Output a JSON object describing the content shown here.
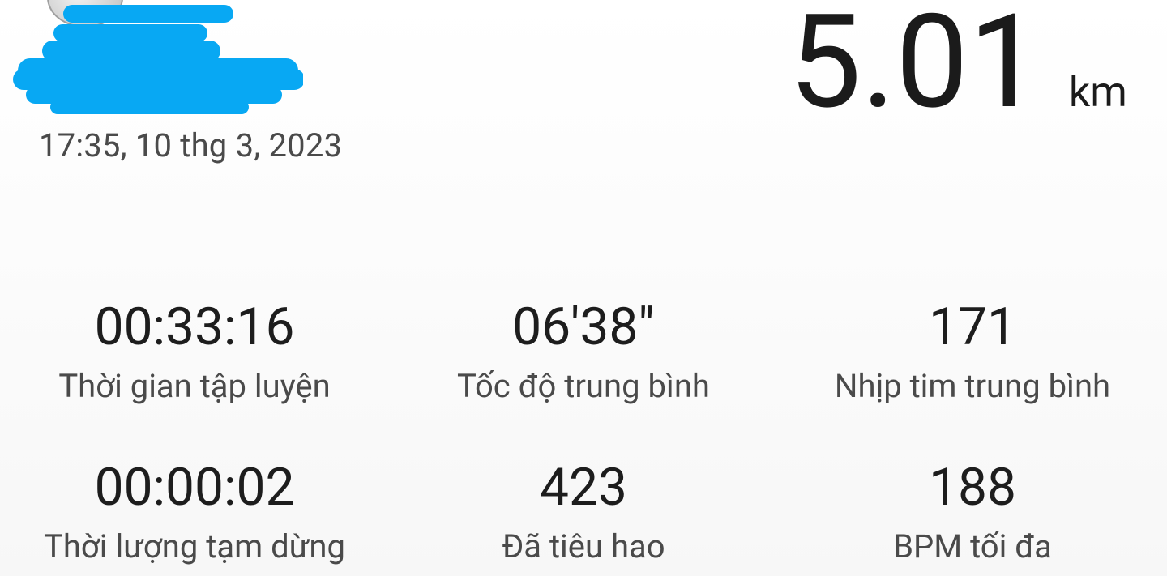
{
  "header": {
    "datetime": "17:35, 10 thg 3, 2023",
    "redaction_color": "#08a8f3"
  },
  "distance": {
    "value": "5.01",
    "unit": "km"
  },
  "stats": {
    "workout_time": {
      "value": "00:33:16",
      "label": "Thời gian tập luyện"
    },
    "avg_speed": {
      "value": "06'38\"",
      "label": "Tốc độ trung bình"
    },
    "avg_heart_rate": {
      "value": "171",
      "label": "Nhịp tim trung bình"
    },
    "pause_duration": {
      "value": "00:00:02",
      "label": "Thời lượng tạm dừng"
    },
    "burned": {
      "value": "423",
      "label": "Đã tiêu hao"
    },
    "max_bpm": {
      "value": "188",
      "label": "BPM tối đa"
    }
  }
}
